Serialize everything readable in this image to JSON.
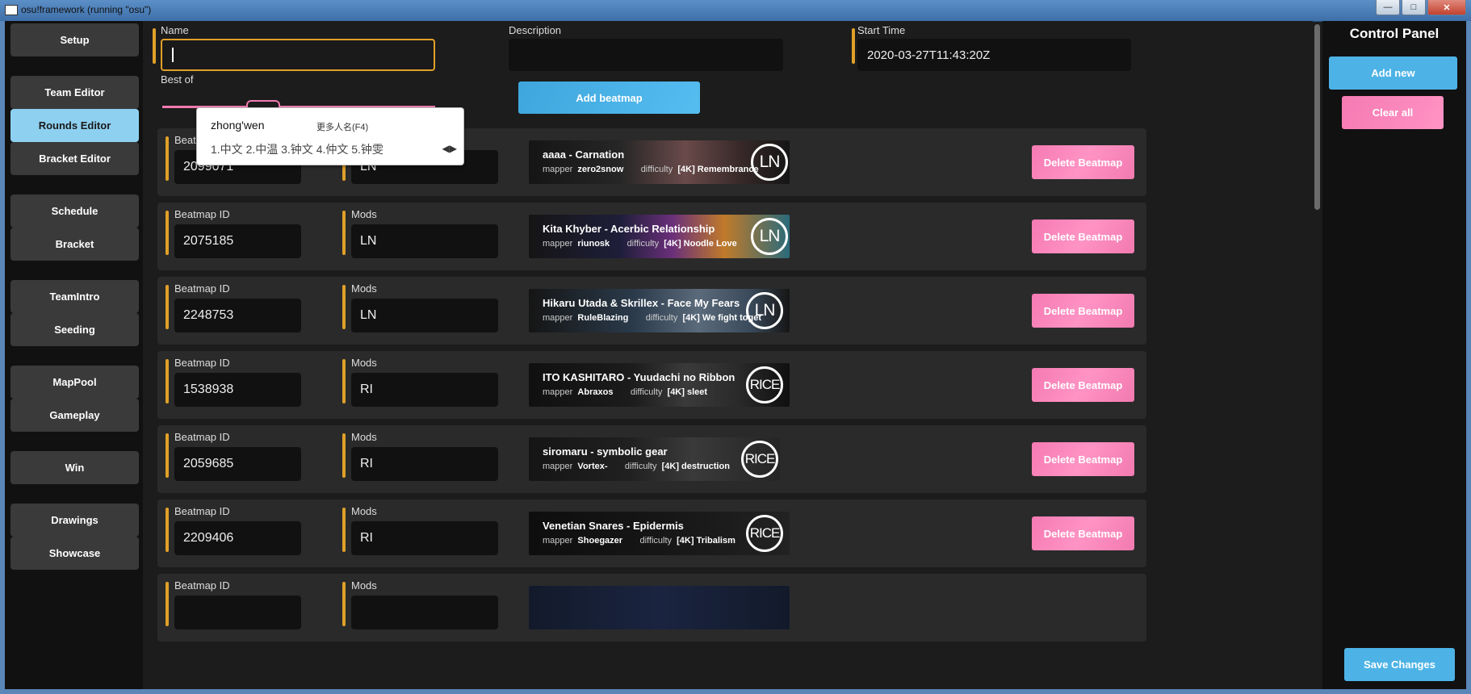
{
  "window": {
    "title": "osu!framework (running \"osu\")"
  },
  "sidebar": {
    "items": [
      {
        "label": "Setup"
      },
      {
        "label": "Team Editor"
      },
      {
        "label": "Rounds Editor"
      },
      {
        "label": "Bracket Editor"
      },
      {
        "label": "Schedule"
      },
      {
        "label": "Bracket"
      },
      {
        "label": "TeamIntro"
      },
      {
        "label": "Seeding"
      },
      {
        "label": "MapPool"
      },
      {
        "label": "Gameplay"
      },
      {
        "label": "Win"
      },
      {
        "label": "Drawings"
      },
      {
        "label": "Showcase"
      }
    ]
  },
  "round": {
    "name_label": "Name",
    "name_value": "",
    "description_label": "Description",
    "description_value": "",
    "start_time_label": "Start Time",
    "start_time_value": "2020-03-27T11:43:20Z",
    "best_of_label": "Best of",
    "add_beatmap_label": "Add beatmap"
  },
  "ime": {
    "composition": "zhong'wen",
    "hint": "更多人名(F4)",
    "candidates": "1.中文  2.中温  3.钟文  4.仲文  5.钟雯"
  },
  "beatmaps": {
    "id_label": "Beatmap ID",
    "mods_label": "Mods",
    "mapper_label": "mapper",
    "difficulty_label": "difficulty",
    "delete_label": "Delete Beatmap",
    "rows": [
      {
        "id": "2099071",
        "mods": "LN",
        "title": "aaaa - Carnation",
        "mapper": "zero2snow",
        "difficulty": "[4K] Remembrance",
        "mod_badge": "LN"
      },
      {
        "id": "2075185",
        "mods": "LN",
        "title": "Kita Khyber - Acerbic Relationship",
        "mapper": "riunosk",
        "difficulty": "[4K] Noodle Love",
        "mod_badge": "LN"
      },
      {
        "id": "2248753",
        "mods": "LN",
        "title": "Hikaru Utada & Skrillex - Face My Fears",
        "mapper": "RuleBlazing",
        "difficulty": "[4K] We fight toget",
        "mod_badge": "LN"
      },
      {
        "id": "1538938",
        "mods": "RI",
        "title": "ITO KASHITARO - Yuudachi no Ribbon",
        "mapper": "Abraxos",
        "difficulty": "[4K] sleet",
        "mod_badge": "RICE"
      },
      {
        "id": "2059685",
        "mods": "RI",
        "title": "siromaru - symbolic gear",
        "mapper": "Vortex-",
        "difficulty": "[4K] destruction",
        "mod_badge": "RICE"
      },
      {
        "id": "2209406",
        "mods": "RI",
        "title": "Venetian Snares - Epidermis",
        "mapper": "Shoegazer",
        "difficulty": "[4K] Tribalism",
        "mod_badge": "RICE"
      },
      {
        "id": "",
        "mods": "",
        "title": "",
        "mapper": "",
        "difficulty": "",
        "mod_badge": ""
      }
    ]
  },
  "control_panel": {
    "title": "Control Panel",
    "add_new_label": "Add new",
    "clear_all_label": "Clear all",
    "save_label": "Save Changes"
  },
  "colors": {
    "accent": "#e0a028",
    "primary_blue": "#4db3e6",
    "pink": "#f57ab3",
    "active_sidebar": "#8ed0f0"
  }
}
